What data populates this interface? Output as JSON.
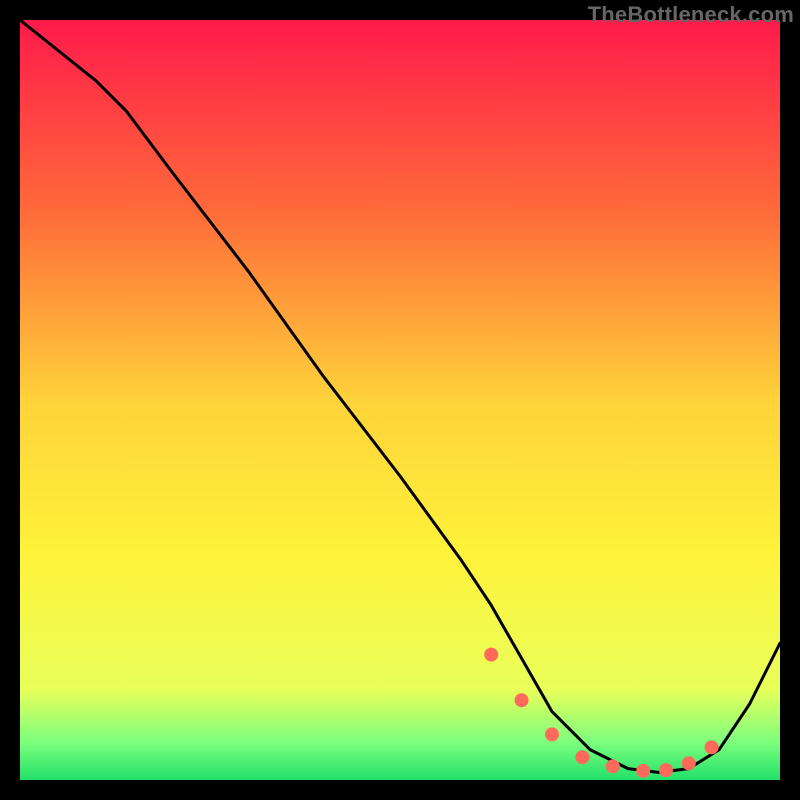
{
  "watermark": "TheBottleneck.com",
  "chart_data": {
    "type": "line",
    "title": "",
    "xlabel": "",
    "ylabel": "",
    "xlim": [
      0,
      100
    ],
    "ylim": [
      0,
      100
    ],
    "grid": false,
    "legend": false,
    "gradient_stops": [
      {
        "offset": 0,
        "color": "#ff1a4b"
      },
      {
        "offset": 0.25,
        "color": "#ff6a3a"
      },
      {
        "offset": 0.5,
        "color": "#ffd23a"
      },
      {
        "offset": 0.7,
        "color": "#fff23a"
      },
      {
        "offset": 0.88,
        "color": "#e9ff5a"
      },
      {
        "offset": 0.95,
        "color": "#7dff7d"
      },
      {
        "offset": 1.0,
        "color": "#22e06a"
      }
    ],
    "series": [
      {
        "name": "curve",
        "x": [
          0,
          10,
          14,
          20,
          30,
          40,
          50,
          58,
          62,
          66,
          70,
          75,
          80,
          84,
          88,
          92,
          96,
          100
        ],
        "values": [
          100,
          92,
          88,
          80,
          67,
          53,
          40,
          29,
          23,
          16,
          9,
          4,
          1.5,
          1,
          1.5,
          4,
          10,
          18
        ]
      }
    ],
    "markers": {
      "name": "dots",
      "x": [
        62,
        66,
        70,
        74,
        78,
        82,
        85,
        88,
        91
      ],
      "values": [
        16.5,
        10.5,
        6,
        3,
        1.8,
        1.2,
        1.3,
        2.2,
        4.3
      ],
      "color": "#ff6a5a",
      "radius": 7
    }
  }
}
